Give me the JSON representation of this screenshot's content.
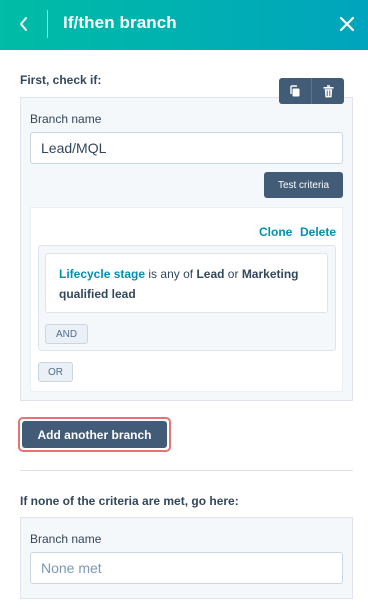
{
  "header": {
    "title": "If/then branch",
    "back_icon": "chevron-left-icon",
    "close_icon": "close-icon"
  },
  "first_section": {
    "label": "First, check if:",
    "toolbar": {
      "clone_icon": "copy-icon",
      "delete_icon": "trash-icon"
    },
    "branch_name_label": "Branch name",
    "branch_name_value": "Lead/MQL",
    "test_button": "Test criteria",
    "criteria": {
      "clone_link": "Clone",
      "delete_link": "Delete",
      "filter": {
        "property": "Lifecycle stage",
        "operator": "is any of",
        "value1": "Lead",
        "conjunction": "or",
        "value2": "Marketing qualified lead"
      },
      "and_button": "AND",
      "or_button": "OR"
    }
  },
  "add_branch_button": "Add another branch",
  "fallback_section": {
    "label": "If none of the criteria are met, go here:",
    "branch_name_label": "Branch name",
    "placeholder": "None met"
  },
  "colors": {
    "header_gradient_start": "#00bda5",
    "header_gradient_end": "#00a4bd",
    "primary_dark": "#425b76",
    "link": "#0091ae",
    "highlight_border": "#e57373"
  }
}
